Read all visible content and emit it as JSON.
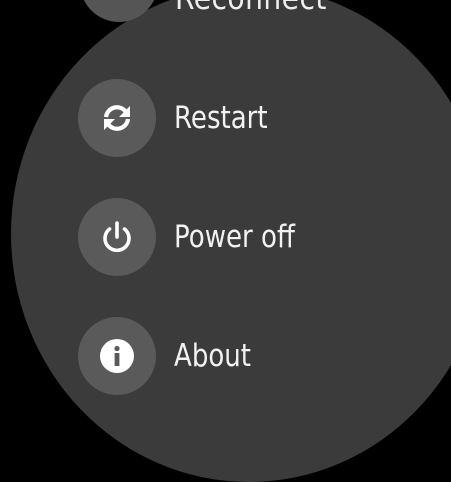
{
  "menu": {
    "partial_top_label": "Reconnect",
    "items": [
      {
        "label": "Restart",
        "icon": "restart-icon"
      },
      {
        "label": "Power off",
        "icon": "power-icon"
      },
      {
        "label": "About",
        "icon": "info-icon"
      }
    ]
  },
  "colors": {
    "background": "#000000",
    "face": "#3b3b3b",
    "icon_circle": "#5a5a5a",
    "text": "#f2f2f2"
  }
}
